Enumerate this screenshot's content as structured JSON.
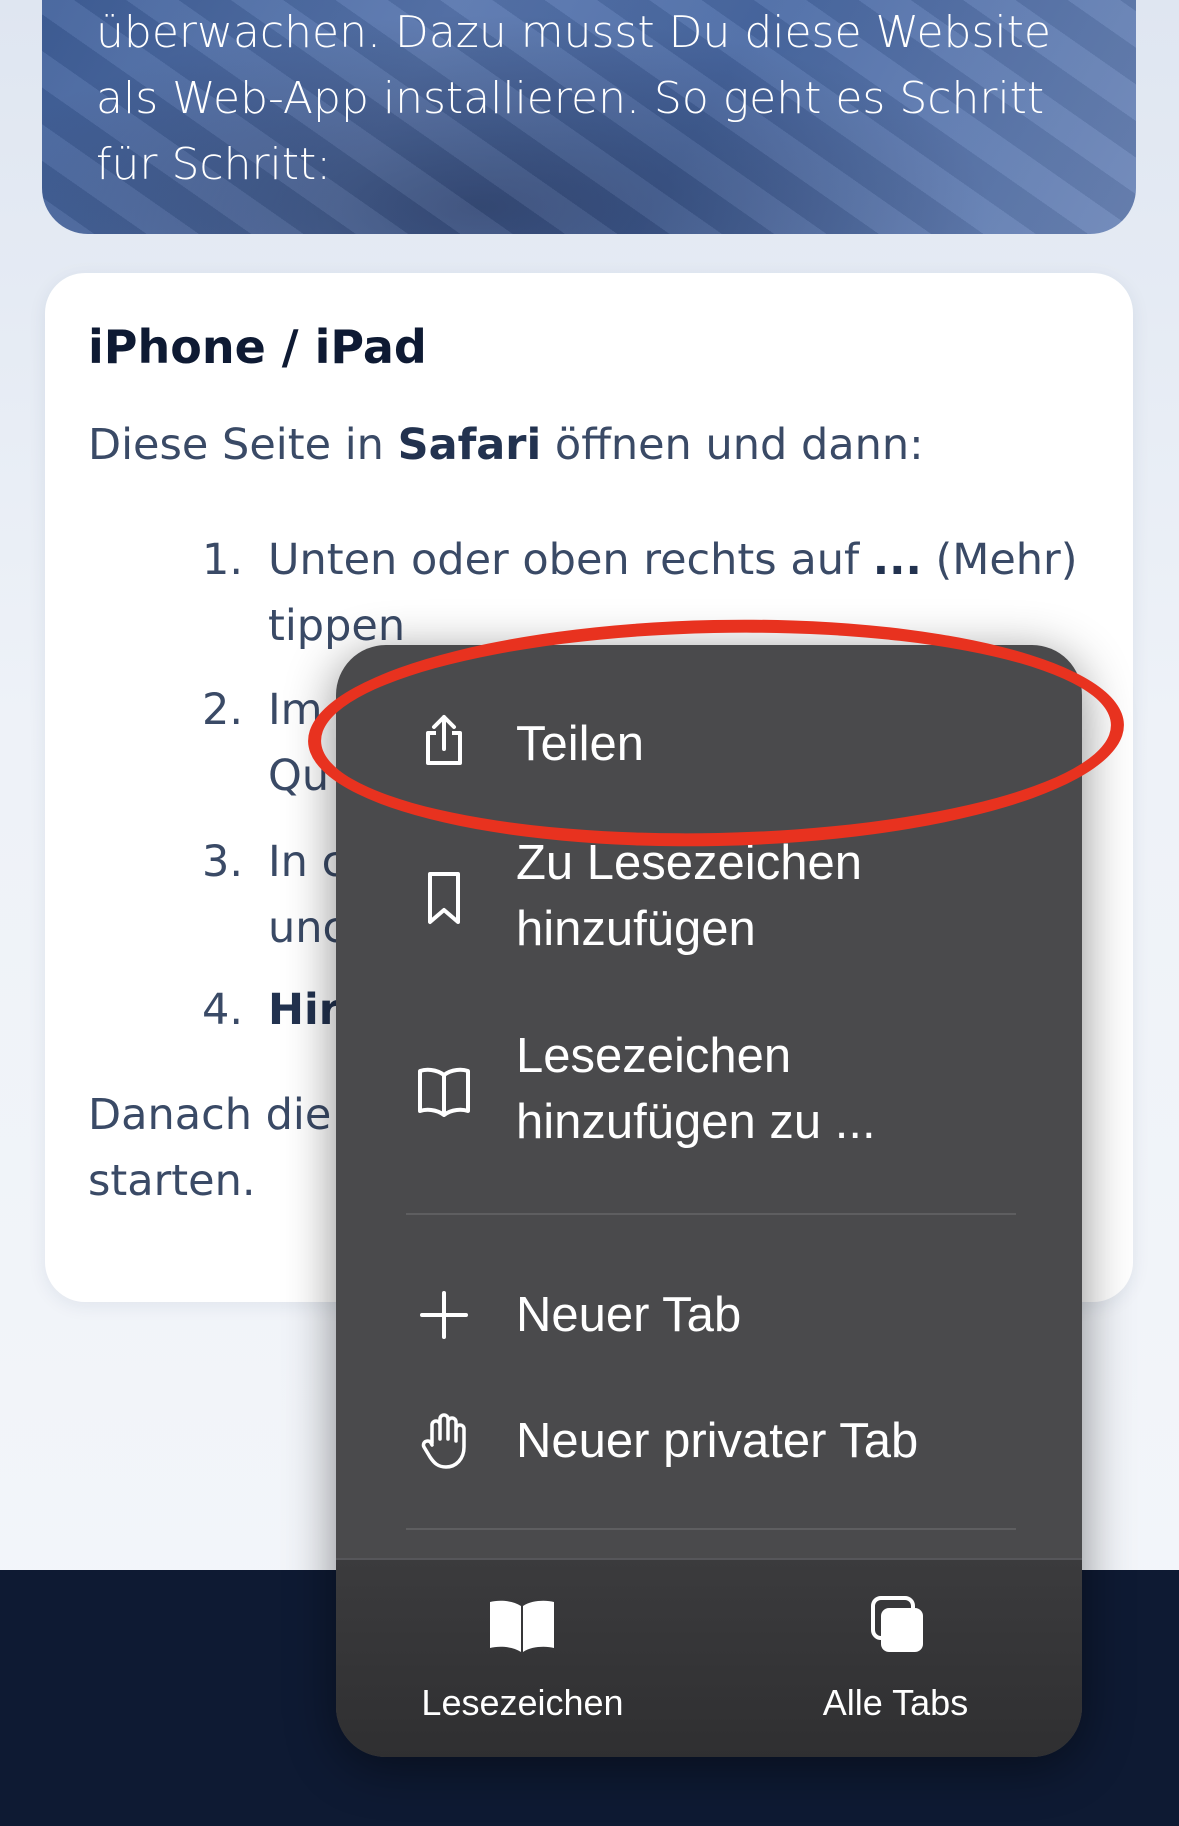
{
  "hero": {
    "text": "überwachen. Dazu musst Du diese Website\nals Web-App installieren. So geht es Schritt\nfür Schritt:"
  },
  "card": {
    "title": "iPhone / iPad",
    "intro_before": "Diese Seite in ",
    "intro_bold": "Safari",
    "intro_after": " öffnen und dann:",
    "steps": [
      {
        "num": "1.",
        "line1_before": "Unten oder oben rechts auf ",
        "line1_bold": "...",
        "line1_after": " (Mehr)",
        "line2": "tippen"
      },
      {
        "num": "2.",
        "line1": "Im",
        "line2": "Qu"
      },
      {
        "num": "3.",
        "line1": "In c",
        "line2": "unc"
      },
      {
        "num": "4.",
        "line1_bold": "Hir"
      }
    ],
    "outro_line1": "Danach die",
    "outro_line2": "starten."
  },
  "menu": {
    "items": [
      {
        "label": "Teilen",
        "icon": "share-icon"
      },
      {
        "label": "Zu Lesezeichen\nhinzufügen",
        "icon": "bookmark-icon"
      },
      {
        "label": "Lesezeichen\nhinzufügen zu ...",
        "icon": "book-icon"
      },
      {
        "label": "Neuer Tab",
        "icon": "plus-icon"
      },
      {
        "label": "Neuer privater Tab",
        "icon": "hand-icon"
      }
    ],
    "toolbar": [
      {
        "label": "Lesezeichen",
        "icon": "book-filled-icon"
      },
      {
        "label": "Alle Tabs",
        "icon": "tabs-icon"
      }
    ]
  },
  "colors": {
    "accent_red": "#e8321f",
    "menu_bg": "#4a4a4c",
    "footer_bg": "#0e1a33"
  }
}
